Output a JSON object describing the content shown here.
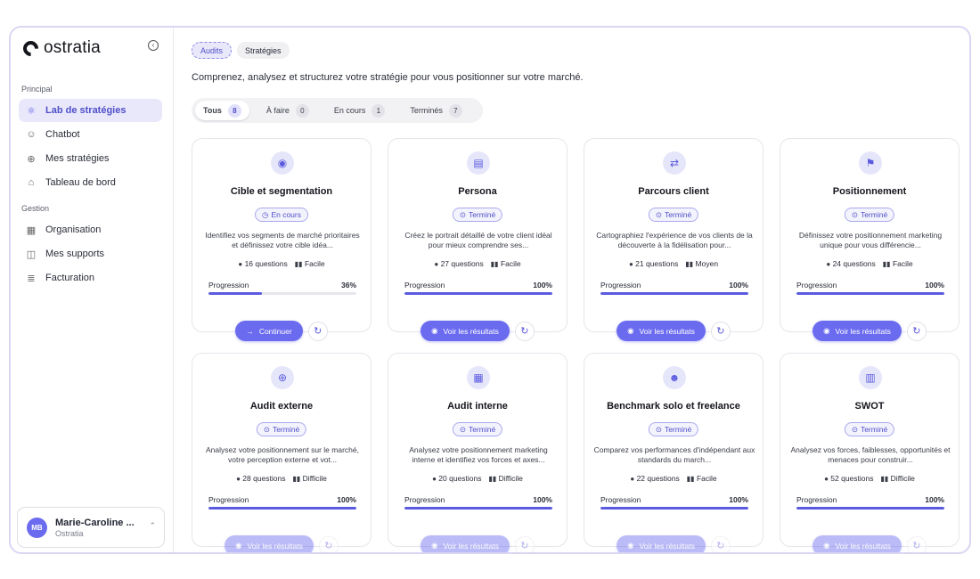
{
  "app": {
    "name": "ostratia"
  },
  "sidebar": {
    "section_principal": "Principal",
    "section_gestion": "Gestion",
    "principal_items": [
      {
        "label": "Lab de stratégies",
        "icon": "lab-icon",
        "active": true
      },
      {
        "label": "Chatbot",
        "icon": "chat-icon",
        "active": false
      },
      {
        "label": "Mes stratégies",
        "icon": "compass-icon",
        "active": false
      },
      {
        "label": "Tableau de bord",
        "icon": "dashboard-icon",
        "active": false
      }
    ],
    "gestion_items": [
      {
        "label": "Organisation",
        "icon": "building-icon",
        "active": false
      },
      {
        "label": "Mes supports",
        "icon": "folder-icon",
        "active": false
      },
      {
        "label": "Facturation",
        "icon": "invoice-icon",
        "active": false
      }
    ],
    "user": {
      "initials": "MB",
      "name": "Marie-Caroline ...",
      "org": "Ostratia"
    }
  },
  "main": {
    "tabs": [
      {
        "label": "Audits",
        "active": true
      },
      {
        "label": "Stratégies",
        "active": false
      }
    ],
    "subtitle": "Comprenez, analysez et structurez votre stratégie pour vous positionner sur votre marché.",
    "filters": [
      {
        "label": "Tous",
        "count": "8",
        "active": true
      },
      {
        "label": "À faire",
        "count": "0",
        "active": false
      },
      {
        "label": "En cours",
        "count": "1",
        "active": false
      },
      {
        "label": "Terminés",
        "count": "7",
        "active": false
      }
    ],
    "progress_label": "Progression",
    "cards": [
      {
        "title": "Cible et segmentation",
        "status": "En cours",
        "icon": "target-icon",
        "desc": "Identifiez vos segments de marché prioritaires et définissez votre cible idéa...",
        "questions": "16 questions",
        "level": "Facile",
        "progress": 36,
        "progress_text": "36%",
        "action": "Continuer"
      },
      {
        "title": "Persona",
        "status": "Terminé",
        "icon": "id-card-icon",
        "desc": "Créez le portrait détaillé de votre client idéal pour mieux comprendre ses...",
        "questions": "27 questions",
        "level": "Facile",
        "progress": 100,
        "progress_text": "100%",
        "action": "Voir les résultats"
      },
      {
        "title": "Parcours client",
        "status": "Terminé",
        "icon": "route-icon",
        "desc": "Cartographiez l'expérience de vos clients de la découverte à la fidélisation pour...",
        "questions": "21 questions",
        "level": "Moyen",
        "progress": 100,
        "progress_text": "100%",
        "action": "Voir les résultats"
      },
      {
        "title": "Positionnement",
        "status": "Terminé",
        "icon": "flag-icon",
        "desc": "Définissez votre positionnement marketing unique pour vous différencie...",
        "questions": "24 questions",
        "level": "Facile",
        "progress": 100,
        "progress_text": "100%",
        "action": "Voir les résultats"
      },
      {
        "title": "Audit externe",
        "status": "Terminé",
        "icon": "globe-icon",
        "desc": "Analysez votre positionnement sur le marché, votre perception externe et vot...",
        "questions": "28 questions",
        "level": "Difficile",
        "progress": 100,
        "progress_text": "100%",
        "action": "Voir les résultats"
      },
      {
        "title": "Audit interne",
        "status": "Terminé",
        "icon": "building-icon",
        "desc": "Analysez votre positionnement marketing interne et identifiez vos forces et axes...",
        "questions": "20 questions",
        "level": "Difficile",
        "progress": 100,
        "progress_text": "100%",
        "action": "Voir les résultats"
      },
      {
        "title": "Benchmark solo et freelance",
        "status": "Terminé",
        "icon": "users-icon",
        "desc": "Comparez vos performances d'indépendant aux standards du march...",
        "questions": "22 questions",
        "level": "Facile",
        "progress": 100,
        "progress_text": "100%",
        "action": "Voir les résultats"
      },
      {
        "title": "SWOT",
        "status": "Terminé",
        "icon": "bar-chart-icon",
        "desc": "Analysez vos forces, faiblesses, opportunités et menaces pour construir...",
        "questions": "52 questions",
        "level": "Difficile",
        "progress": 100,
        "progress_text": "100%",
        "action": "Voir les résultats"
      }
    ]
  },
  "colors": {
    "accent": "#6b6bf0",
    "accent_soft": "#e9e8fb",
    "border": "#e6e6ec"
  }
}
